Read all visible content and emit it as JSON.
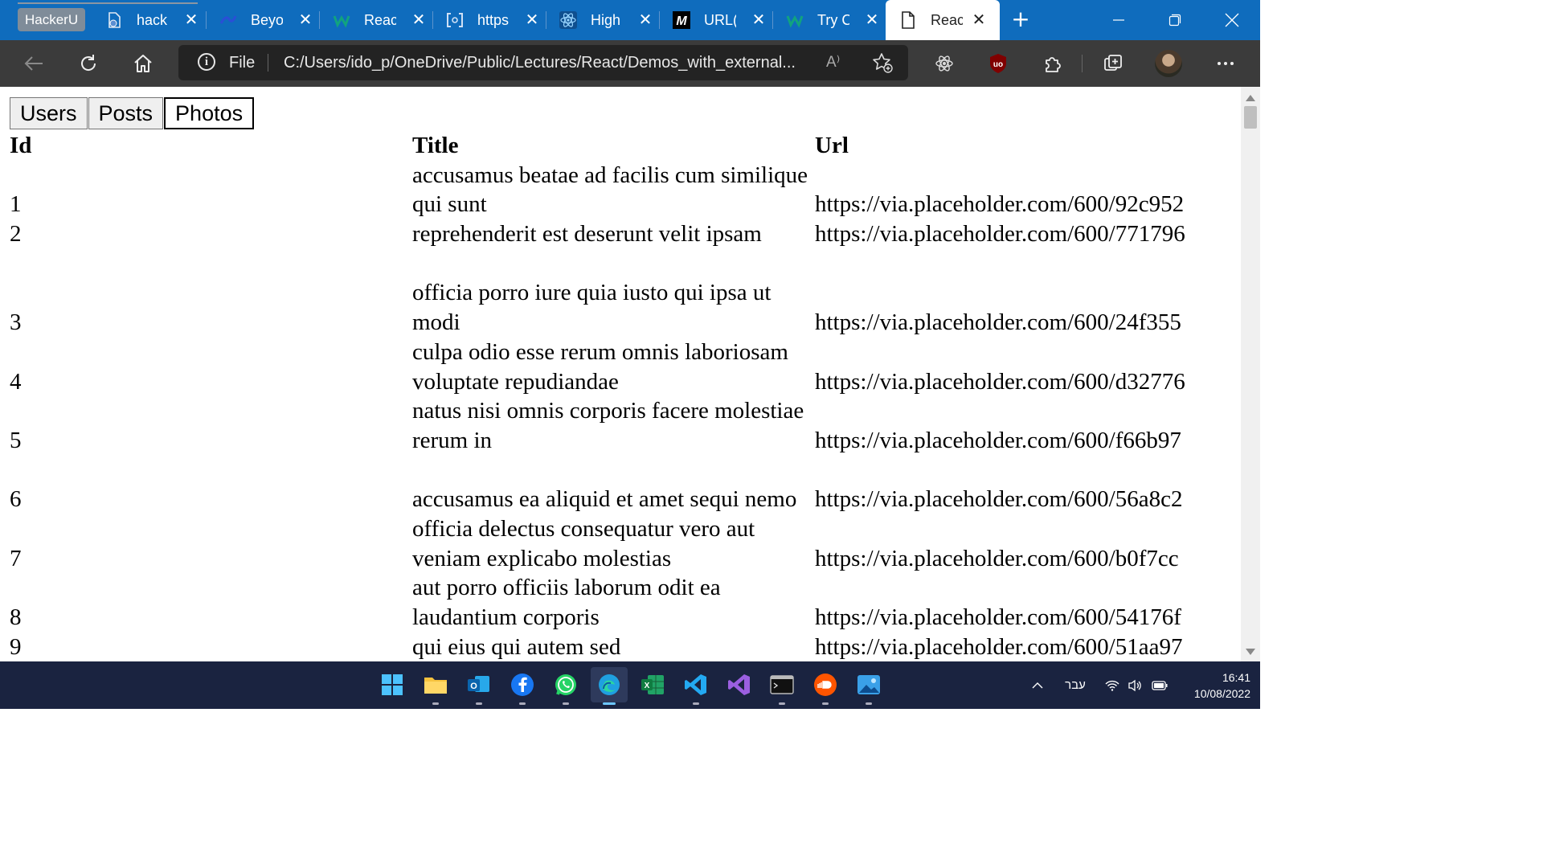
{
  "browser": {
    "tab_group_label": "HackerU",
    "tabs": [
      {
        "label": "hack",
        "icon": "file-icon"
      },
      {
        "label": "Beyo",
        "icon": "beyond-icon"
      },
      {
        "label": "Reac",
        "icon": "w-icon"
      },
      {
        "label": "https",
        "icon": "bracket-icon"
      },
      {
        "label": "High",
        "icon": "react-icon"
      },
      {
        "label": "URL(",
        "icon": "m-icon"
      },
      {
        "label": "Try C",
        "icon": "w-icon"
      },
      {
        "label": "Reac",
        "icon": "page-icon"
      }
    ],
    "address": {
      "protocol_label": "File",
      "url": "C:/Users/ido_p/OneDrive/Public/Lectures/React/Demos_with_external...",
      "read_aloud": "A⁾"
    }
  },
  "page": {
    "nav_buttons": [
      "Users",
      "Posts",
      "Photos"
    ],
    "selected_nav": "Photos",
    "table": {
      "headers": [
        "Id",
        "Title",
        "Url"
      ],
      "rows": [
        {
          "id": "1",
          "title": "accusamus beatae ad facilis cum similique qui sunt",
          "url": "https://via.placeholder.com/600/92c952"
        },
        {
          "id": "2",
          "title": "reprehenderit est deserunt velit ipsam",
          "url": "https://via.placeholder.com/600/771796"
        },
        {
          "id": "3",
          "title": "officia porro iure quia iusto qui ipsa ut modi",
          "url": "https://via.placeholder.com/600/24f355"
        },
        {
          "id": "4",
          "title": "culpa odio esse rerum omnis laboriosam voluptate repudiandae",
          "url": "https://via.placeholder.com/600/d32776"
        },
        {
          "id": "5",
          "title": "natus nisi omnis corporis facere molestiae rerum in",
          "url": "https://via.placeholder.com/600/f66b97"
        },
        {
          "id": "6",
          "title": "accusamus ea aliquid et amet sequi nemo",
          "url": "https://via.placeholder.com/600/56a8c2"
        },
        {
          "id": "7",
          "title": "officia delectus consequatur vero aut veniam explicabo molestias",
          "url": "https://via.placeholder.com/600/b0f7cc"
        },
        {
          "id": "8",
          "title": "aut porro officiis laborum odit ea laudantium corporis",
          "url": "https://via.placeholder.com/600/54176f"
        },
        {
          "id": "9",
          "title": "qui eius qui autem sed",
          "url": "https://via.placeholder.com/600/51aa97"
        }
      ]
    }
  },
  "taskbar": {
    "apps": [
      "windows-start",
      "file-explorer",
      "outlook",
      "facebook",
      "whatsapp",
      "edge",
      "excel",
      "vscode",
      "visual-studio",
      "terminal",
      "soundcloud",
      "photos"
    ],
    "language": "עבר",
    "time": "16:41",
    "date": "10/08/2022"
  },
  "colors": {
    "tab_strip": "#0f6cbd",
    "toolbar": "#3b3b3b",
    "taskbar": "#1a2340"
  }
}
